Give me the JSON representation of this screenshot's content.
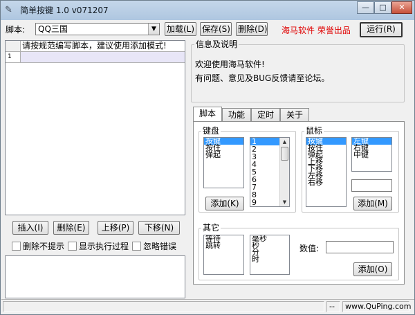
{
  "window": {
    "title": "简单按键 1.0 v071207",
    "title_icon": "pen-icon",
    "min_glyph": "—",
    "max_glyph": "□",
    "close_glyph": "✕"
  },
  "toolbar": {
    "script_label": "脚本:",
    "script_value": "QQ三国",
    "load_label": "加载(L)",
    "save_label": "保存(S)",
    "delete_label": "删除(D)",
    "brand_text": "海马软件  荣誉出品",
    "run_label": "运行(R)"
  },
  "script_table": {
    "header_text": "请按规范编写脚本，建议使用添加模式!",
    "row1_number": "1"
  },
  "editor_buttons": {
    "insert_label": "插入(I)",
    "delete_label": "删除(E)",
    "move_up_label": "上移(P)",
    "move_down_label": "下移(N)"
  },
  "options": {
    "no_delete_prompt": "删除不提示",
    "show_process": "显示执行过程",
    "ignore_errors": "忽略错误"
  },
  "info": {
    "title": "信息及说明",
    "line1": "欢迎使用海马软件!",
    "line2": "有问题、意见及BUG反馈请至论坛。"
  },
  "tabs": [
    {
      "label": "脚本"
    },
    {
      "label": "功能"
    },
    {
      "label": "定时"
    },
    {
      "label": "关于"
    }
  ],
  "keyboard": {
    "title": "键盘",
    "actions": [
      "按键",
      "按住",
      "弹起"
    ],
    "selected_action": "按键",
    "keys": [
      "1",
      "2",
      "3",
      "4",
      "5",
      "6",
      "7",
      "8",
      "9"
    ],
    "selected_key": "1",
    "add_label": "添加(K)"
  },
  "mouse": {
    "title": "鼠标",
    "actions": [
      "按键",
      "按住",
      "弹起",
      "上移",
      "下移",
      "左移",
      "右移"
    ],
    "selected_action": "按键",
    "buttons": [
      "左键",
      "右键",
      "中键"
    ],
    "selected_button": "左键",
    "add_label": "添加(M)"
  },
  "other": {
    "title": "其它",
    "actions": [
      "等待",
      "跳转"
    ],
    "units": [
      "毫秒",
      "秒",
      "分",
      "时"
    ],
    "value_label": "数值:",
    "add_label": "添加(O)"
  },
  "status": {
    "dash": "--",
    "website": "www.QuPing.com"
  },
  "colors": {
    "brand_red": "#e00000",
    "selection_blue": "#3399ff",
    "row_highlight": "#e8e6f7"
  }
}
